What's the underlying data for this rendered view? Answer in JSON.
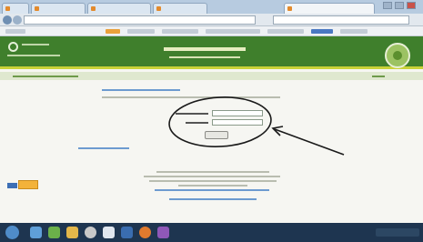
{
  "browser": {
    "tabs": [
      "",
      "",
      "",
      "",
      ""
    ],
    "address_bar": {
      "value": ""
    },
    "search_box": {
      "value": ""
    }
  },
  "page": {
    "header": {
      "site_name": "",
      "banner_title": "",
      "banner_subtitle": ""
    },
    "subbar": {
      "left_link": "",
      "right_link": ""
    },
    "login": {
      "heading": "",
      "instructions": "",
      "email_label": "",
      "email_value": "",
      "password_label": "",
      "password_value": "",
      "button_label": "",
      "forgot_link": ""
    },
    "footer": {
      "text": "",
      "links": []
    }
  },
  "colors": {
    "header_green": "#3f7f2c",
    "header_accent": "#c9d238",
    "annotation_ink": "#1a1a1a"
  }
}
